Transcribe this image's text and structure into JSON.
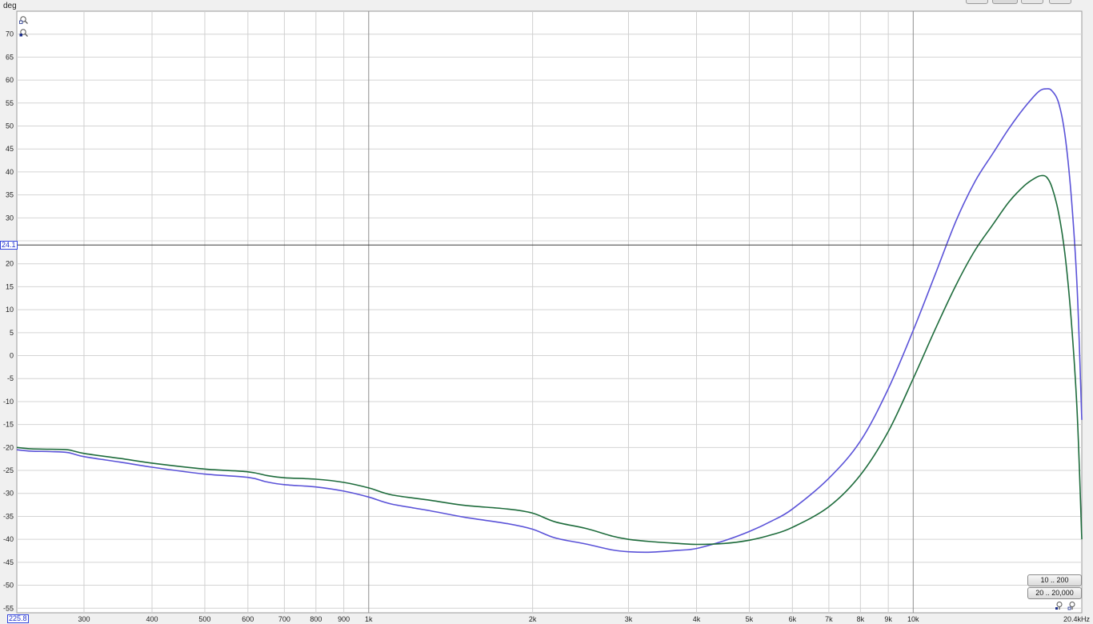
{
  "header": {
    "unit": "deg"
  },
  "cursor": {
    "y_readout": "24.1",
    "x_readout": "225.8"
  },
  "buttons": {
    "range_low": "10 .. 200",
    "range_full": "20 .. 20,000"
  },
  "icons": {
    "zoom_in_y": "zoom-in-icon",
    "zoom_out_y": "zoom-out-icon",
    "zoom_out_x": "zoom-out-icon",
    "zoom_in_x": "zoom-in-icon"
  },
  "chart_data": {
    "type": "line",
    "x_scale": "log",
    "xlim": [
      225.8,
      20400
    ],
    "ylim": [
      -56,
      75
    ],
    "grid": true,
    "cursor_y": 24.1,
    "x_tick_values": [
      300,
      400,
      500,
      600,
      700,
      800,
      900,
      1000,
      2000,
      3000,
      4000,
      5000,
      6000,
      7000,
      8000,
      9000,
      10000,
      20400
    ],
    "x_tick_labels": [
      "300",
      "400",
      "500",
      "600",
      "700",
      "800",
      "900",
      "1k",
      "2k",
      "3k",
      "4k",
      "5k",
      "6k",
      "7k",
      "8k",
      "9k",
      "10k",
      "20.4kHz"
    ],
    "y_tick_values": [
      70,
      65,
      60,
      55,
      50,
      45,
      40,
      35,
      30,
      20,
      15,
      10,
      5,
      0,
      -5,
      -10,
      -15,
      -20,
      -25,
      -30,
      -35,
      -40,
      -45,
      -50,
      -55
    ],
    "y_tick_labels": [
      "70",
      "65",
      "60",
      "55",
      "50",
      "45",
      "40",
      "35",
      "30",
      "20",
      "15",
      "10",
      "5",
      "0",
      "-5",
      "-10",
      "-15",
      "-20",
      "-25",
      "-30",
      "-35",
      "-40",
      "-45",
      "-50",
      "-55"
    ],
    "series": [
      {
        "color": "#5a52d8",
        "x": [
          225.8,
          240,
          260,
          280,
          300,
          350,
          400,
          500,
          600,
          650,
          700,
          800,
          900,
          1000,
          1100,
          1300,
          1500,
          1800,
          2000,
          2200,
          2500,
          2800,
          3000,
          3300,
          3700,
          4000,
          4500,
          5000,
          5500,
          6000,
          7000,
          8000,
          9000,
          10000,
          11000,
          12000,
          13000,
          14000,
          15000,
          16000,
          17000,
          17600,
          18000,
          18500,
          19000,
          19500,
          20000,
          20400
        ],
        "y": [
          -20.5,
          -20.8,
          -20.9,
          -21.1,
          -22.0,
          -23.2,
          -24.3,
          -25.8,
          -26.5,
          -27.5,
          -28.1,
          -28.6,
          -29.5,
          -30.8,
          -32.3,
          -33.8,
          -35.2,
          -36.6,
          -37.8,
          -39.7,
          -41.0,
          -42.3,
          -42.7,
          -42.8,
          -42.4,
          -42.0,
          -40.3,
          -38.3,
          -36.0,
          -33.4,
          -26.7,
          -18.6,
          -7.2,
          5.5,
          18.0,
          29.5,
          38.0,
          44.0,
          49.5,
          54.0,
          57.5,
          58.1,
          57.6,
          55.0,
          48.0,
          35.0,
          15.0,
          -14.0
        ]
      },
      {
        "color": "#1d6b3b",
        "x": [
          225.8,
          240,
          260,
          280,
          300,
          350,
          400,
          500,
          600,
          650,
          700,
          800,
          900,
          1000,
          1100,
          1300,
          1500,
          1800,
          2000,
          2200,
          2500,
          2800,
          3000,
          3300,
          3700,
          4000,
          4500,
          5000,
          5500,
          6000,
          7000,
          8000,
          9000,
          10000,
          11000,
          12000,
          13000,
          14000,
          15000,
          16000,
          16700,
          17200,
          17600,
          18000,
          18500,
          19000,
          19500,
          20000,
          20400
        ],
        "y": [
          -20.0,
          -20.3,
          -20.4,
          -20.5,
          -21.3,
          -22.4,
          -23.4,
          -24.7,
          -25.3,
          -26.1,
          -26.6,
          -26.9,
          -27.6,
          -28.8,
          -30.3,
          -31.5,
          -32.6,
          -33.4,
          -34.3,
          -36.2,
          -37.6,
          -39.3,
          -40.0,
          -40.5,
          -40.9,
          -41.1,
          -40.9,
          -40.2,
          -39.0,
          -37.4,
          -32.9,
          -26.0,
          -16.5,
          -5.0,
          6.0,
          15.5,
          23.0,
          28.5,
          33.5,
          37.0,
          38.6,
          39.2,
          38.8,
          36.5,
          31.0,
          22.0,
          8.0,
          -12.0,
          -40.0
        ]
      }
    ]
  }
}
